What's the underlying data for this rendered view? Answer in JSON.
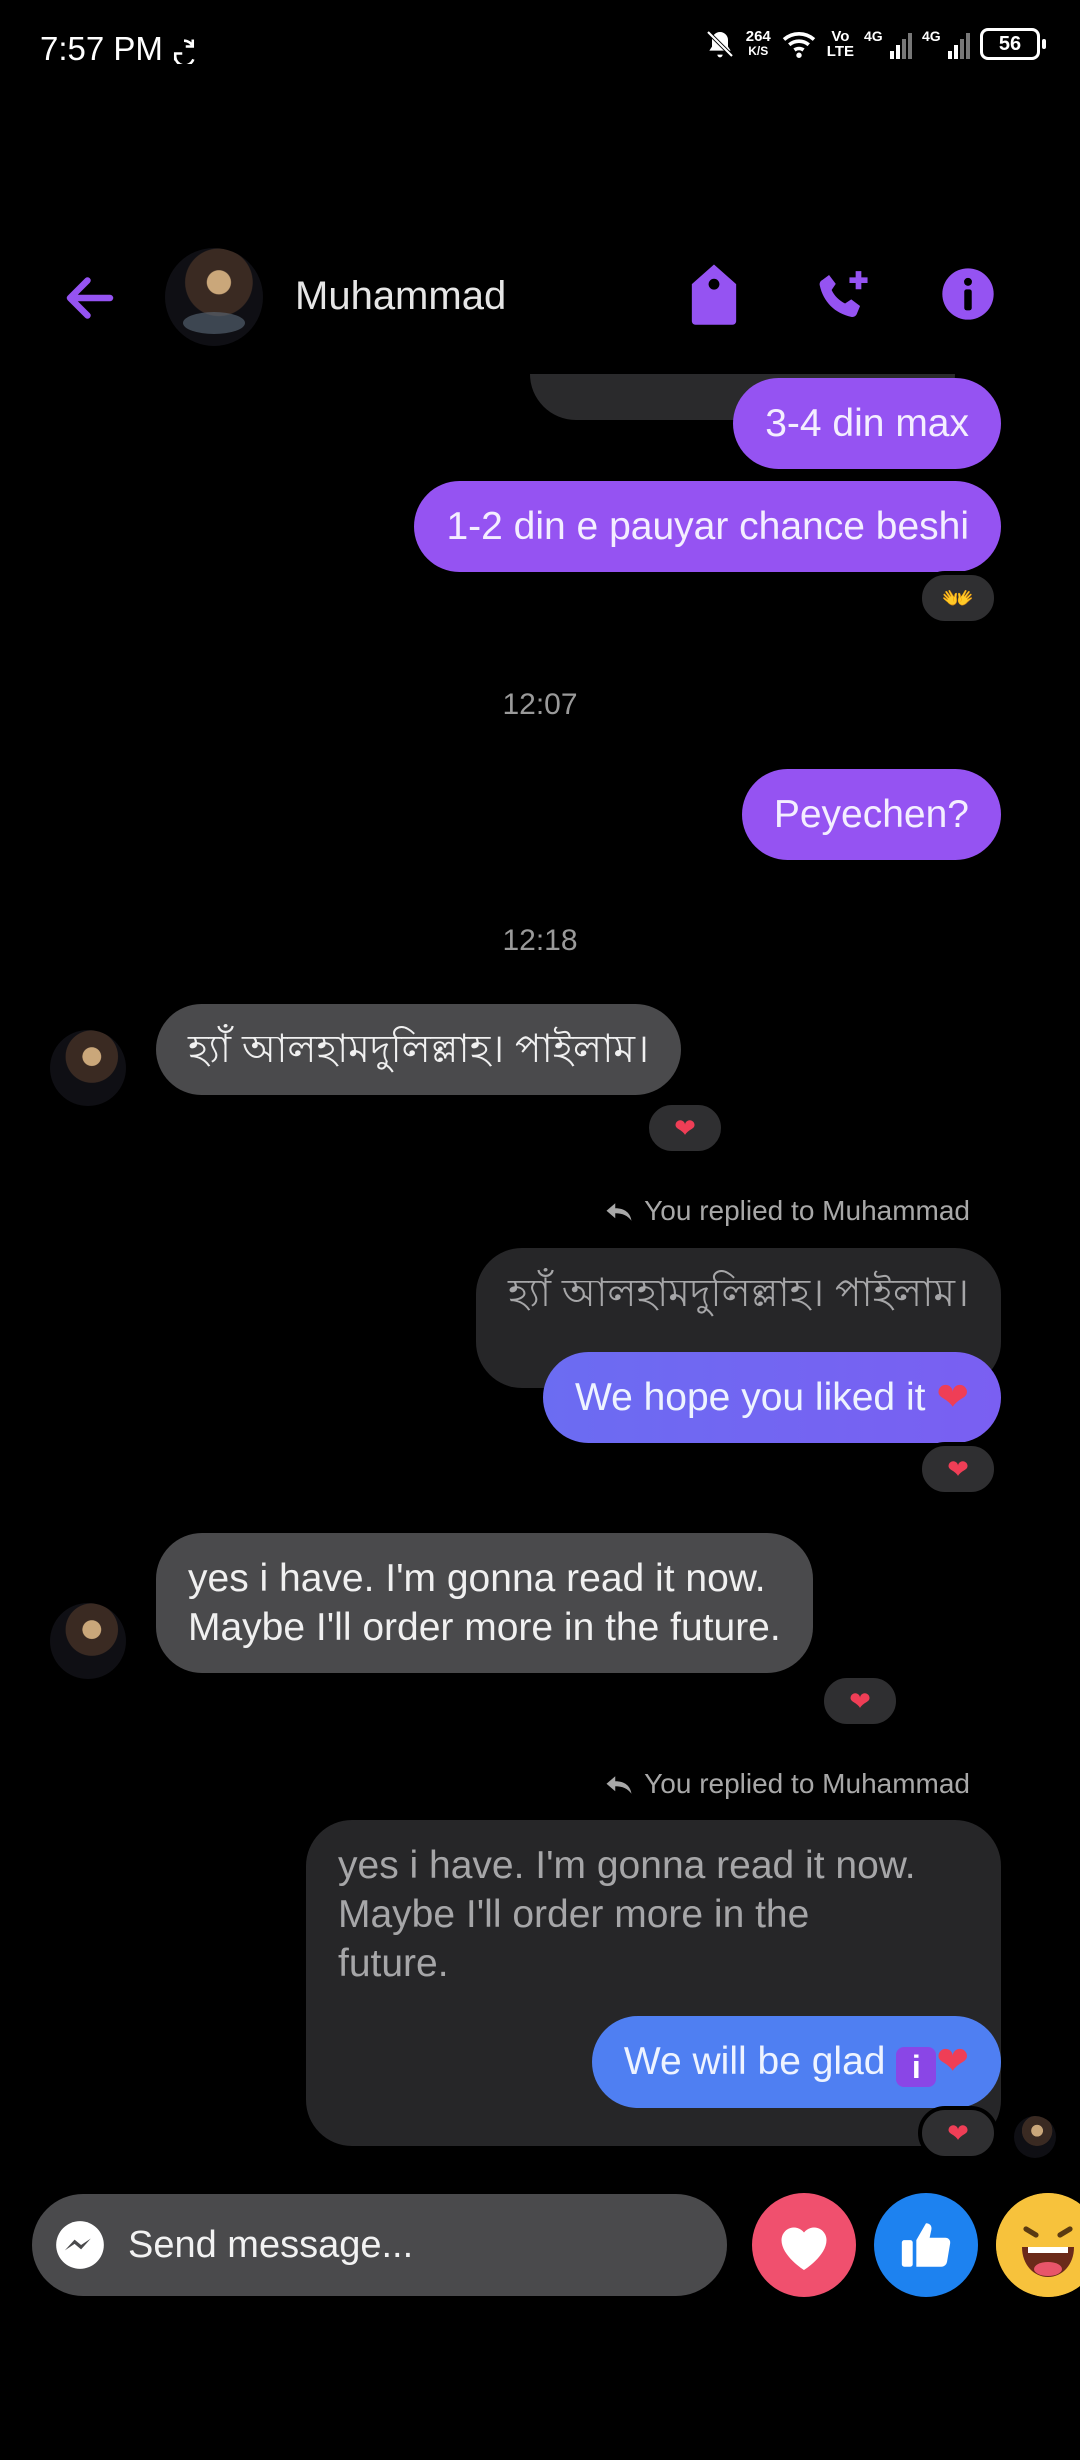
{
  "status_bar": {
    "time": "7:57 PM",
    "speed_value": "264",
    "speed_unit": "K/S",
    "volte_top": "Vo",
    "volte_bottom": "LTE",
    "net1": "4G",
    "net2": "4G",
    "battery": "56"
  },
  "header": {
    "contact_name": "Muhammad"
  },
  "messages": {
    "m1": "3-4 din max",
    "m2": "1-2 din e pauyar chance beshi",
    "ts1": "12:07",
    "m3": "Peyechen?",
    "ts2": "12:18",
    "m4": "হ্যাঁ আলহামদুলিল্লাহ। পাইলাম।",
    "reply1_note": "You replied to Muhammad",
    "reply1_quote": "হ্যাঁ আলহামদুলিল্লাহ। পাইলাম।",
    "m5": "We hope you liked it",
    "m6_line1": "yes i have. I'm gonna read it now.",
    "m6_line2": "Maybe I'll order more in the future.",
    "reply2_note": "You replied to Muhammad",
    "reply2_quote_line1": "yes i have. I'm gonna read it now.",
    "reply2_quote_line2": "Maybe I'll order more in the",
    "reply2_quote_line3": "future.",
    "m7": "We will be glad",
    "m7_badge": "i"
  },
  "reactions": {
    "heart": "❤",
    "hands": "👐"
  },
  "composer": {
    "placeholder": "Send message..."
  },
  "colors": {
    "accent": "#9553f2",
    "outgoing_blue": "#4f7ff2",
    "incoming": "#4a4a4c",
    "heart": "#f0506e",
    "like": "#1d82f0"
  }
}
